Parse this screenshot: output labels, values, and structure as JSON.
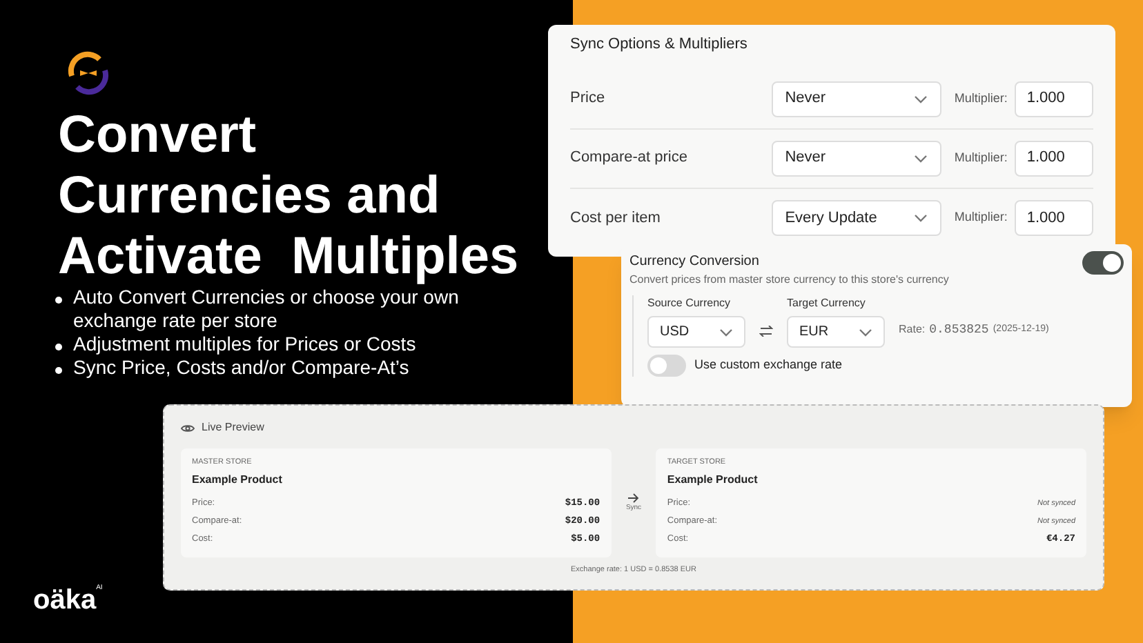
{
  "headline": [
    "Convert",
    "Currencies and",
    "Activate  Multiples"
  ],
  "bullets": [
    "Auto Convert Currencies or choose your own exchange rate per store",
    "Adjustment multiples for Prices or Costs",
    "Sync Price, Costs and/or Compare-At’s"
  ],
  "brand": {
    "name": "oäka",
    "mark": "AI"
  },
  "sync_options": {
    "title": "Sync Options & Multipliers",
    "rows": [
      {
        "label": "Price",
        "frequency": "Never",
        "multiplier_label": "Multiplier:",
        "multiplier": "1.000"
      },
      {
        "label": "Compare-at price",
        "frequency": "Never",
        "multiplier_label": "Multiplier:",
        "multiplier": "1.000"
      },
      {
        "label": "Cost per item",
        "frequency": "Every Update",
        "multiplier_label": "Multiplier:",
        "multiplier": "1.000"
      }
    ]
  },
  "currency_conversion": {
    "title": "Currency Conversion",
    "description": "Convert prices from master store currency to this store's currency",
    "on": true,
    "source_label": "Source Currency",
    "source": "USD",
    "target_label": "Target Currency",
    "target": "EUR",
    "rate_label": "Rate:",
    "rate": "0.853825",
    "rate_date": "(2025-12-19)",
    "custom_rate": {
      "label": "Use custom exchange rate",
      "on": false
    }
  },
  "live_preview": {
    "title": "Live Preview",
    "sync_label": "Sync",
    "exchange_rate": "Exchange rate: 1 USD = 0.8538 EUR",
    "stores": [
      {
        "heading": "MASTER STORE",
        "product": "Example Product",
        "fields": [
          {
            "label": "Price:",
            "value": "$15.00",
            "synced": true
          },
          {
            "label": "Compare-at:",
            "value": "$20.00",
            "synced": true
          },
          {
            "label": "Cost:",
            "value": "$5.00",
            "synced": true
          }
        ]
      },
      {
        "heading": "TARGET STORE",
        "product": "Example Product",
        "fields": [
          {
            "label": "Price:",
            "value": "Not synced",
            "synced": false
          },
          {
            "label": "Compare-at:",
            "value": "Not synced",
            "synced": false
          },
          {
            "label": "Cost:",
            "value": "€4.27",
            "synced": true
          }
        ]
      }
    ]
  }
}
